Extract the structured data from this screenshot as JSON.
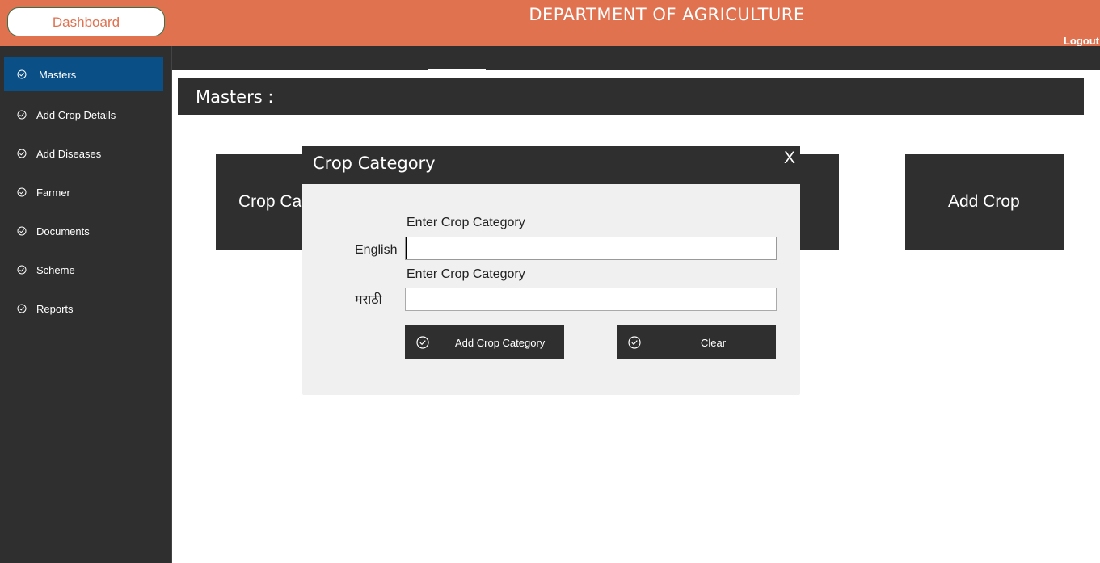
{
  "header": {
    "dashboard_label": "Dashboard",
    "title": "DEPARTMENT OF AGRICULTURE",
    "logout_label": "Logout",
    "bg_color": "#e07250"
  },
  "sidebar": {
    "items": [
      {
        "label": "Masters",
        "icon": "check-circle-icon",
        "active": true
      },
      {
        "label": "Add Crop Details",
        "icon": "check-circle-icon"
      },
      {
        "label": "Add Diseases",
        "icon": "check-circle-icon"
      },
      {
        "label": "Farmer",
        "icon": "check-circle-icon"
      },
      {
        "label": "Documents",
        "icon": "check-circle-icon"
      },
      {
        "label": "Scheme",
        "icon": "check-circle-icon"
      },
      {
        "label": "Reports",
        "icon": "check-circle-icon"
      }
    ],
    "active_color": "#0a4f86"
  },
  "main": {
    "heading": "Masters :",
    "tiles": [
      {
        "label": "Crop Ca"
      },
      {
        "label": ""
      },
      {
        "label": "Add Crop"
      }
    ]
  },
  "modal": {
    "title": "Crop Category",
    "close_label": "X",
    "fields": [
      {
        "caption": "Enter Crop Category",
        "label": "English",
        "value": "",
        "placeholder": ""
      },
      {
        "caption": "Enter Crop Category",
        "label": "मराठी",
        "value": "",
        "placeholder": ""
      }
    ],
    "buttons": {
      "add_label": "Add Crop Category",
      "clear_label": "Clear"
    }
  }
}
